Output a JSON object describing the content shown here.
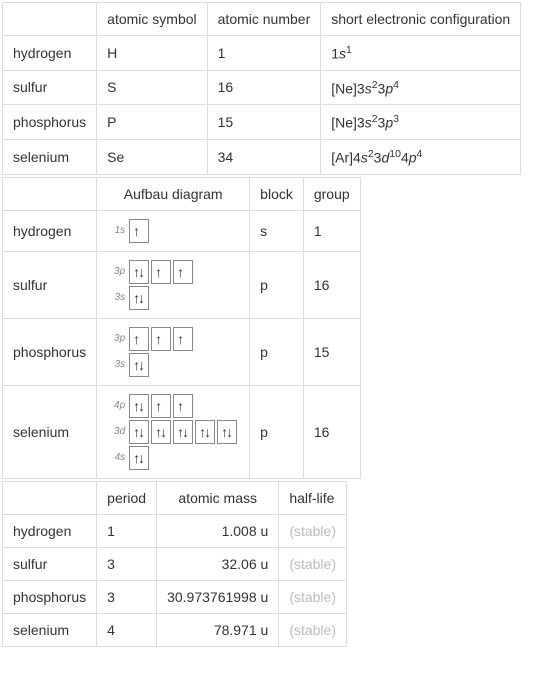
{
  "table1": {
    "headers": {
      "symbol": "atomic symbol",
      "number": "atomic number",
      "config": "short electronic configuration"
    },
    "rows": [
      {
        "name": "hydrogen",
        "symbol": "H",
        "number": "1",
        "config_html": "1<i>s</i><sup>1</sup>"
      },
      {
        "name": "sulfur",
        "symbol": "S",
        "number": "16",
        "config_html": "[Ne]3<i>s</i><sup>2</sup>3<i>p</i><sup>4</sup>"
      },
      {
        "name": "phosphorus",
        "symbol": "P",
        "number": "15",
        "config_html": "[Ne]3<i>s</i><sup>2</sup>3<i>p</i><sup>3</sup>"
      },
      {
        "name": "selenium",
        "symbol": "Se",
        "number": "34",
        "config_html": "[Ar]4<i>s</i><sup>2</sup>3<i>d</i><sup>10</sup>4<i>p</i><sup>4</sup>"
      }
    ]
  },
  "table2": {
    "headers": {
      "aufbau": "Aufbau diagram",
      "block": "block",
      "group": "group"
    },
    "rows": [
      {
        "name": "hydrogen",
        "block": "s",
        "group": "1",
        "orbitals": [
          {
            "label": "1s",
            "boxes": [
              {
                "up": true,
                "down": false
              }
            ]
          }
        ]
      },
      {
        "name": "sulfur",
        "block": "p",
        "group": "16",
        "orbitals": [
          {
            "label": "3p",
            "boxes": [
              {
                "up": true,
                "down": true
              },
              {
                "up": true,
                "down": false
              },
              {
                "up": true,
                "down": false
              }
            ]
          },
          {
            "label": "3s",
            "boxes": [
              {
                "up": true,
                "down": true
              }
            ]
          }
        ]
      },
      {
        "name": "phosphorus",
        "block": "p",
        "group": "15",
        "orbitals": [
          {
            "label": "3p",
            "boxes": [
              {
                "up": true,
                "down": false
              },
              {
                "up": true,
                "down": false
              },
              {
                "up": true,
                "down": false
              }
            ]
          },
          {
            "label": "3s",
            "boxes": [
              {
                "up": true,
                "down": true
              }
            ]
          }
        ]
      },
      {
        "name": "selenium",
        "block": "p",
        "group": "16",
        "orbitals": [
          {
            "label": "4p",
            "boxes": [
              {
                "up": true,
                "down": true
              },
              {
                "up": true,
                "down": false
              },
              {
                "up": true,
                "down": false
              }
            ]
          },
          {
            "label": "3d",
            "boxes": [
              {
                "up": true,
                "down": true
              },
              {
                "up": true,
                "down": true
              },
              {
                "up": true,
                "down": true
              },
              {
                "up": true,
                "down": true
              },
              {
                "up": true,
                "down": true
              }
            ]
          },
          {
            "label": "4s",
            "boxes": [
              {
                "up": true,
                "down": true
              }
            ]
          }
        ]
      }
    ]
  },
  "table3": {
    "headers": {
      "period": "period",
      "mass": "atomic mass",
      "halflife": "half-life"
    },
    "rows": [
      {
        "name": "hydrogen",
        "period": "1",
        "mass": "1.008 u",
        "halflife": "(stable)"
      },
      {
        "name": "sulfur",
        "period": "3",
        "mass": "32.06 u",
        "halflife": "(stable)"
      },
      {
        "name": "phosphorus",
        "period": "3",
        "mass": "30.973761998 u",
        "halflife": "(stable)"
      },
      {
        "name": "selenium",
        "period": "4",
        "mass": "78.971 u",
        "halflife": "(stable)"
      }
    ]
  }
}
